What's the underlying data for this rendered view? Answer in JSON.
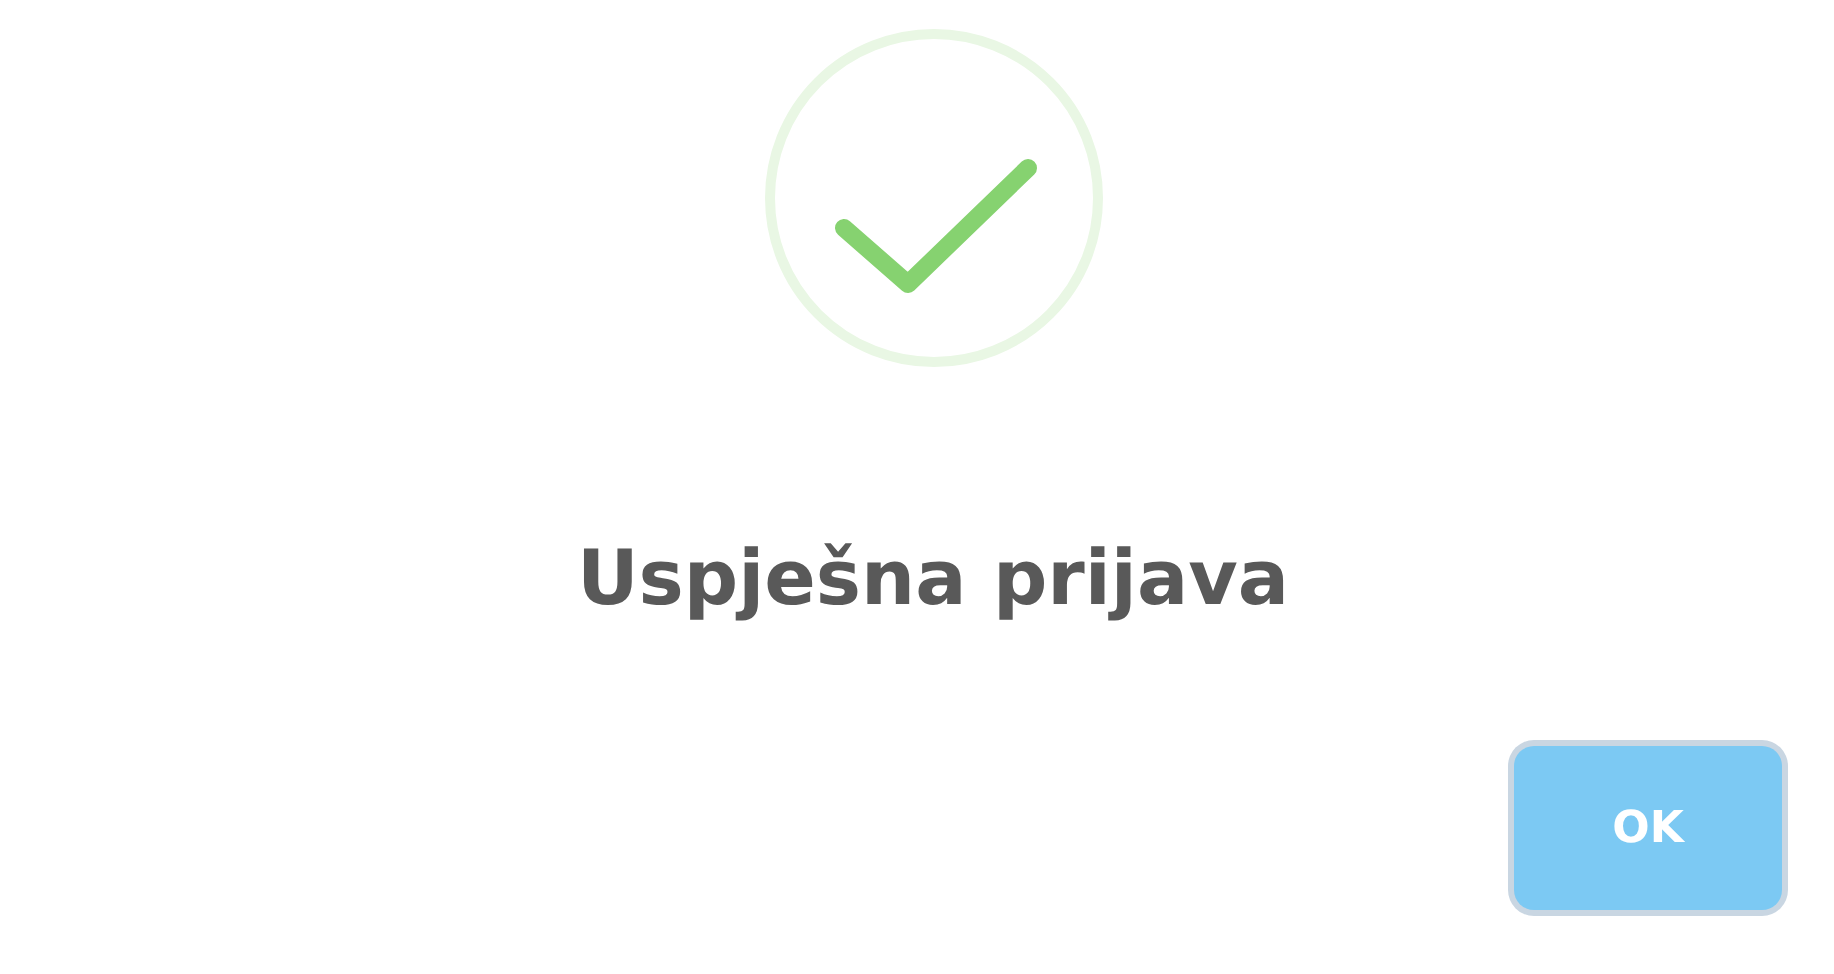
{
  "dialog": {
    "icon": {
      "kind": "success"
    },
    "title": "Uspješna prijava",
    "buttons": [
      {
        "label": "OK",
        "focused": true
      }
    ]
  }
}
